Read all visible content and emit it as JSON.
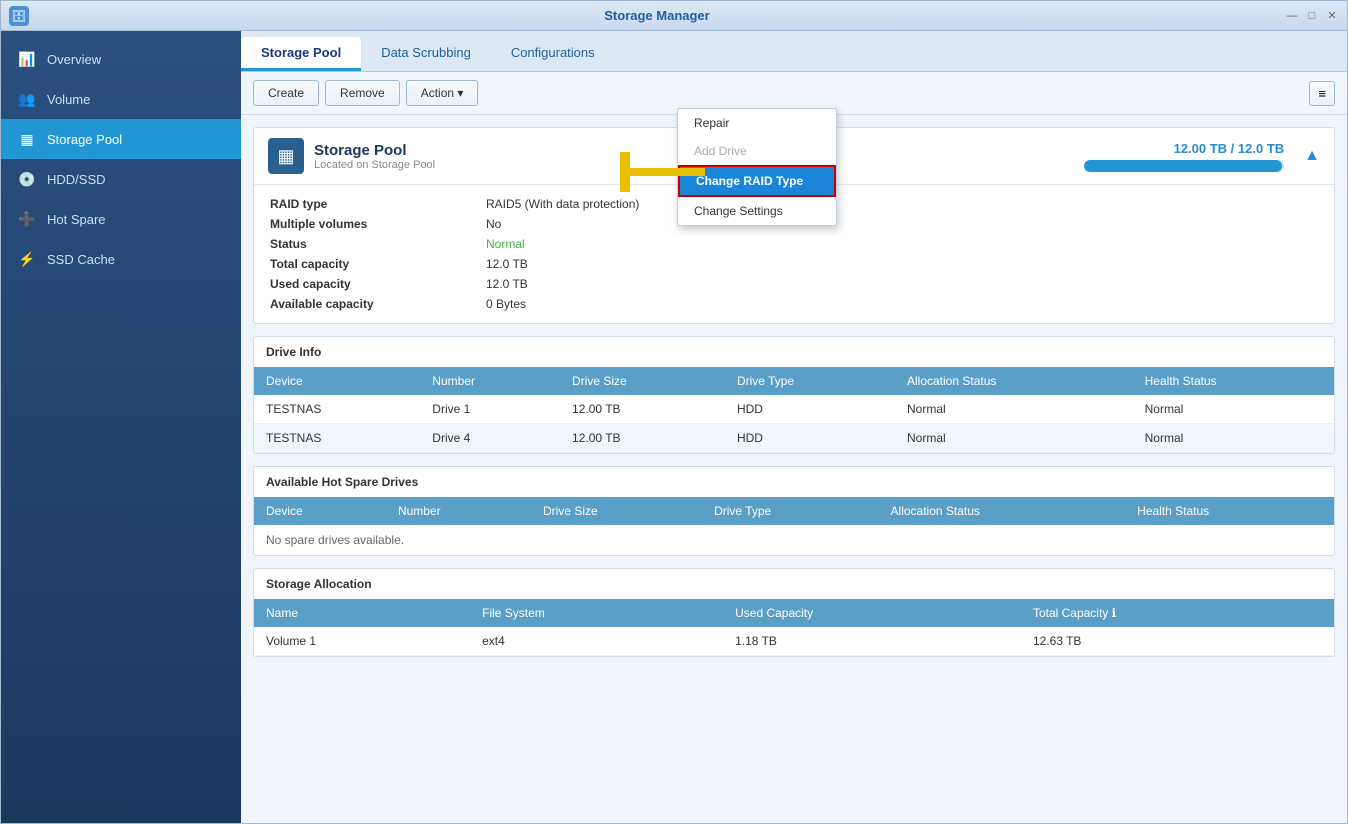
{
  "app": {
    "title": "Storage Manager",
    "icon": "🗄"
  },
  "titlebar": {
    "controls": [
      "—",
      "□",
      "✕"
    ]
  },
  "sidebar": {
    "items": [
      {
        "id": "overview",
        "label": "Overview",
        "icon": "📊",
        "active": false
      },
      {
        "id": "volume",
        "label": "Volume",
        "icon": "👥",
        "active": false
      },
      {
        "id": "storage-pool",
        "label": "Storage Pool",
        "icon": "▦",
        "active": true
      },
      {
        "id": "hdd-ssd",
        "label": "HDD/SSD",
        "icon": "💿",
        "active": false
      },
      {
        "id": "hot-spare",
        "label": "Hot Spare",
        "icon": "➕",
        "active": false
      },
      {
        "id": "ssd-cache",
        "label": "SSD Cache",
        "icon": "⚡",
        "active": false
      }
    ]
  },
  "tabs": [
    {
      "id": "storage-pool",
      "label": "Storage Pool",
      "active": true
    },
    {
      "id": "data-scrubbing",
      "label": "Data Scrubbing",
      "active": false
    },
    {
      "id": "configurations",
      "label": "Configurations",
      "active": false
    }
  ],
  "toolbar": {
    "create_label": "Create",
    "remove_label": "Remove",
    "action_label": "Action ▾",
    "list_icon": "≡"
  },
  "dropdown": {
    "items": [
      {
        "id": "repair",
        "label": "Repair",
        "disabled": false,
        "highlighted": false
      },
      {
        "id": "add-drive",
        "label": "Add Drive",
        "disabled": true,
        "highlighted": false
      },
      {
        "id": "change-raid-type",
        "label": "Change RAID Type",
        "disabled": false,
        "highlighted": true
      },
      {
        "id": "change-settings",
        "label": "Change Settings",
        "disabled": false,
        "highlighted": false
      }
    ]
  },
  "pool": {
    "name": "Storage Pool",
    "subtitle": "Located on Storage Pool",
    "capacity_text": "12.00 TB / 12.0  TB",
    "capacity_percent": 99,
    "details": {
      "raid_type_label": "RAID type",
      "raid_type_value": "RAID5  (With data protection)",
      "multiple_volumes_label": "Multiple volumes",
      "multiple_volumes_value": "No",
      "status_label": "Status",
      "status_value": "Normal",
      "total_capacity_label": "Total capacity",
      "total_capacity_value": "12.0  TB",
      "used_capacity_label": "Used capacity",
      "used_capacity_value": "12.0  TB",
      "available_capacity_label": "Available capacity",
      "available_capacity_value": "0 Bytes"
    }
  },
  "drive_info": {
    "title": "Drive Info",
    "columns": [
      "Device",
      "Number",
      "Drive Size",
      "Drive Type",
      "Allocation Status",
      "Health Status"
    ],
    "rows": [
      {
        "device": "TESTNAS",
        "number": "Drive 1",
        "size": "12.00 TB",
        "type": "HDD",
        "allocation": "Normal",
        "health": "Normal"
      },
      {
        "device": "TESTNAS",
        "number": "Drive 4",
        "size": "12.00 TB",
        "type": "HDD",
        "allocation": "Normal",
        "health": "Normal"
      }
    ]
  },
  "hot_spare": {
    "title": "Available Hot Spare Drives",
    "columns": [
      "Device",
      "Number",
      "Drive Size",
      "Drive Type",
      "Allocation Status",
      "Health Status"
    ],
    "no_data": "No spare drives available."
  },
  "storage_allocation": {
    "title": "Storage Allocation",
    "columns": [
      "Name",
      "File System",
      "Used Capacity",
      "Total Capacity ℹ"
    ],
    "rows": [
      {
        "name": "Volume 1",
        "filesystem": "ext4",
        "used": "1.18 TB",
        "total": "12.63 TB"
      }
    ]
  }
}
